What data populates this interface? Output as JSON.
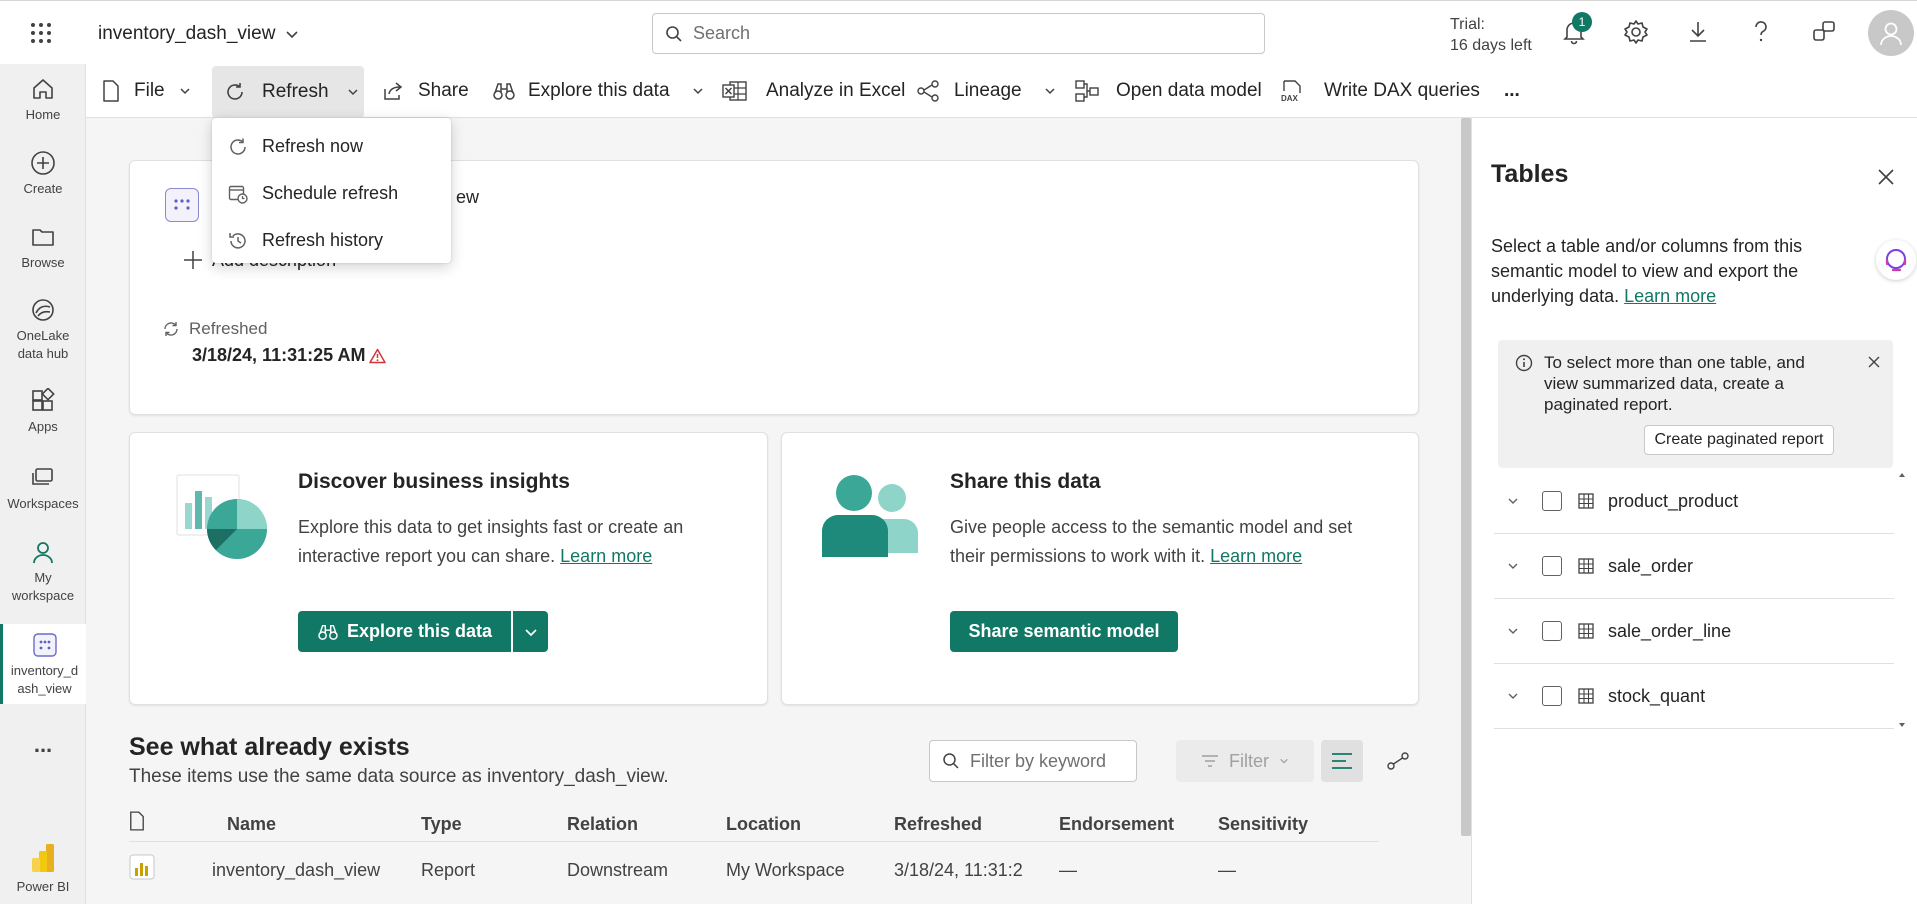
{
  "app": {
    "name": "inventory_dash_view"
  },
  "search": {
    "placeholder": "Search"
  },
  "trial": {
    "line1": "Trial:",
    "line2": "16 days left"
  },
  "notifications": {
    "count": "1"
  },
  "leftnav": {
    "items": [
      {
        "label": "Home"
      },
      {
        "label": "Create"
      },
      {
        "label": "Browse"
      },
      {
        "label": "OneLake data hub"
      },
      {
        "label": "Apps"
      },
      {
        "label": "Workspaces"
      },
      {
        "label": "My workspace"
      },
      {
        "label": "inventory_d ash_view"
      }
    ],
    "more": "...",
    "brand": "Power BI"
  },
  "toolbar": {
    "file": "File",
    "refresh": "Refresh",
    "share": "Share",
    "explore": "Explore this data",
    "excel": "Analyze in Excel",
    "lineage": "Lineage",
    "open_model": "Open data model",
    "dax": "Write DAX queries",
    "more": "..."
  },
  "refresh_menu": {
    "items": [
      {
        "label": "Refresh now"
      },
      {
        "label": "Schedule refresh"
      },
      {
        "label": "Refresh history"
      }
    ]
  },
  "overview": {
    "title_fragment": "ew",
    "add_description": "Add description",
    "refreshed_label": "Refreshed",
    "refreshed_value": "3/18/24, 11:31:25 AM"
  },
  "insights": {
    "title": "Discover business insights",
    "text": "Explore this data to get insights fast or create an interactive report you can share.",
    "link": "Learn more",
    "button": "Explore this data"
  },
  "share_card": {
    "title": "Share this data",
    "text": "Give people access to the semantic model and set their permissions to work with it.",
    "link": "Learn more",
    "button": "Share semantic model"
  },
  "exists": {
    "title": "See what already exists",
    "subtitle": "These items use the same data source as inventory_dash_view.",
    "filter_placeholder": "Filter by keyword",
    "filter_button": "Filter",
    "columns": [
      "Name",
      "Type",
      "Relation",
      "Location",
      "Refreshed",
      "Endorsement",
      "Sensitivity"
    ],
    "rows": [
      {
        "name": "inventory_dash_view",
        "type": "Report",
        "relation": "Downstream",
        "location": "My Workspace",
        "refreshed": "3/18/24, 11:31:2",
        "endorsement": "—",
        "sensitivity": "—"
      }
    ]
  },
  "tables_panel": {
    "title": "Tables",
    "description": "Select a table and/or columns from this semantic model to view and export the underlying data.",
    "link": "Learn more",
    "info": "To select more than one table, and view summarized data, create a paginated report.",
    "create_button": "Create paginated report",
    "tables": [
      {
        "name": "product_product"
      },
      {
        "name": "sale_order"
      },
      {
        "name": "sale_order_line"
      },
      {
        "name": "stock_quant"
      }
    ]
  },
  "colors": {
    "accent": "#117865",
    "warning": "#d13438"
  }
}
